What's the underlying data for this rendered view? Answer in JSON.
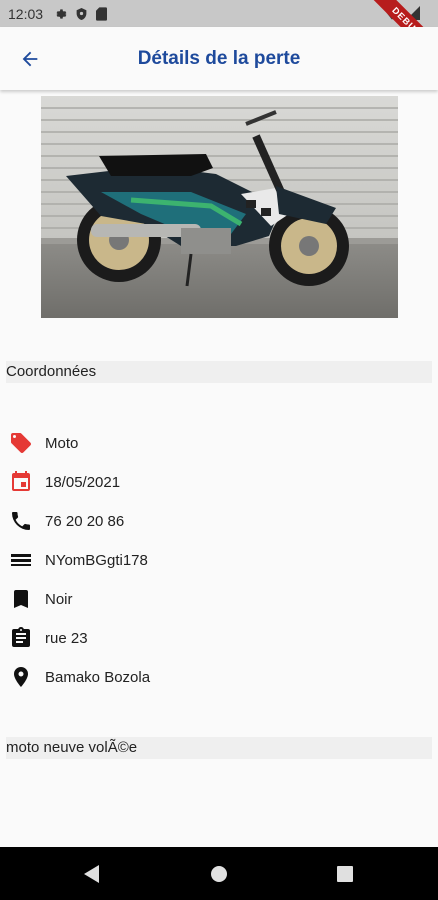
{
  "status_bar": {
    "time": "12:03",
    "debug_banner": "DEBUG"
  },
  "app_bar": {
    "title": "Détails de la perte"
  },
  "photo": {
    "subject": "motorcycle-photo"
  },
  "sections": {
    "coordinates_title": "Coordonnées",
    "description": "moto neuve volÃ©e"
  },
  "details": [
    {
      "icon": "tag-icon",
      "value": "Moto",
      "color": "#e53935"
    },
    {
      "icon": "calendar-icon",
      "value": "18/05/2021",
      "color": "#e53935"
    },
    {
      "icon": "phone-icon",
      "value": "76 20 20 86",
      "color": "#111111"
    },
    {
      "icon": "plate-icon",
      "value": "NYomBGgti178",
      "color": "#111111"
    },
    {
      "icon": "bookmark-icon",
      "value": "Noir",
      "color": "#111111"
    },
    {
      "icon": "clipboard-icon",
      "value": "rue 23",
      "color": "#111111"
    },
    {
      "icon": "location-pin-icon",
      "value": "Bamako Bozola",
      "color": "#111111"
    }
  ],
  "colors": {
    "title": "#1e4a9c",
    "accent": "#e53935"
  }
}
